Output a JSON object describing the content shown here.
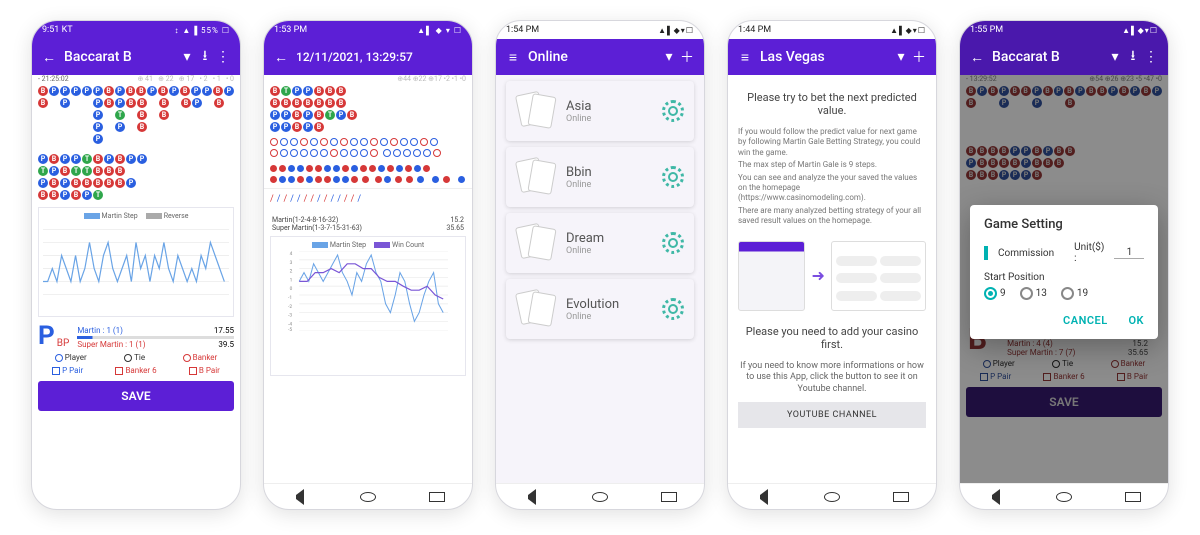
{
  "s1": {
    "status_time": "9:51 KT",
    "status_right": "↕ ▲ ▌55% ☐",
    "title": "Baccarat B",
    "sub": "- 21:25:02",
    "legend1": "Martin Step",
    "legend2": "Reverse",
    "bigP": "P",
    "bp": "BP",
    "martin": "Martin : 1 (1)",
    "super": "Super Martin : 1 (1)",
    "v1": "17.55",
    "v2": "39.5",
    "opt_player": "Player",
    "opt_tie": "Tie",
    "opt_banker": "Banker",
    "opt_ppair": "P Pair",
    "opt_banker6": "Banker 6",
    "opt_bpair": "B Pair",
    "save": "SAVE"
  },
  "s2": {
    "status_time": "1:53 PM",
    "status_right": "▲▌ ◆ ▾ ☐",
    "title": "12/11/2021, 13:29:57",
    "martin_row": "Martin(1-2-4-8-16-32)",
    "martin_val": "15.2",
    "super_row": "Super Martin(1-3-7-15-31-63)",
    "super_val": "35.65",
    "legend1": "Martin Step",
    "legend2": "Win Count"
  },
  "s3": {
    "status_time": "1:54 PM",
    "title": "Online",
    "items": [
      {
        "name": "Asia",
        "sub": "Online"
      },
      {
        "name": "Bbin",
        "sub": "Online"
      },
      {
        "name": "Dream",
        "sub": "Online"
      },
      {
        "name": "Evolution",
        "sub": "Online"
      }
    ]
  },
  "s4": {
    "status_time": "1:44 PM",
    "title": "Las Vegas",
    "headline": "Please try to bet the next predicted value.",
    "p1": "If you would follow the predict value for next game by following Martin Gale Betting Strategy, you could win the game.",
    "p2": "The max step of Martin Gale is 9 steps.",
    "p3": "You can see and analyze the your saved the values on the homepage (https://www.casinomodeling.com).",
    "p4": "There are many analyzed betting strategy of your all saved result values on the homepage.",
    "bottom1": "Please you need to add your casino first.",
    "bottom2": "If you need to know more informations or how to use this App, click the button to see it on Youtube channel.",
    "ytbtn": "YOUTUBE CHANNEL"
  },
  "s5": {
    "status_time": "1:55 PM",
    "title": "Baccarat B",
    "sub": "- 13:29:52",
    "dialog_title": "Game Setting",
    "commission": "Commission",
    "unit_label": "Unit($) :",
    "unit_val": "1",
    "start_pos": "Start Position",
    "r1": "9",
    "r2": "13",
    "r3": "19",
    "cancel": "CANCEL",
    "ok": "OK",
    "martin": "Martin : 4 (4)",
    "super": "Super Martin : 7 (7)",
    "v1": "15.2",
    "v2": "35.65",
    "save": "SAVE",
    "opt_player": "Player",
    "opt_tie": "Tie",
    "opt_banker": "Banker",
    "opt_ppair": "P Pair",
    "opt_banker6": "Banker 6",
    "opt_bpair": "B Pair"
  },
  "chart_data": [
    {
      "type": "line",
      "title": "Martin Step / Reverse",
      "screen": 1,
      "series": [
        {
          "name": "Martin Step",
          "values": [
            1,
            1,
            2,
            1,
            3,
            2,
            1,
            3,
            1,
            2,
            4,
            2,
            1,
            3,
            4,
            2,
            1,
            2,
            3,
            1,
            4,
            2,
            3,
            1,
            3,
            2,
            4,
            2,
            1,
            3,
            2,
            1,
            2,
            1,
            3,
            2,
            4,
            3,
            2,
            1,
            2,
            3,
            1,
            2
          ]
        },
        {
          "name": "Reverse",
          "values": [
            1,
            1,
            1,
            1,
            1,
            1,
            1,
            1,
            1,
            1,
            1,
            1,
            1,
            1,
            1,
            1,
            1,
            1,
            1,
            1,
            1,
            1,
            1,
            1,
            1,
            1,
            1,
            1,
            1,
            1,
            1,
            1,
            1,
            1,
            1,
            1,
            1,
            1,
            1,
            1,
            1,
            1,
            1,
            1
          ]
        }
      ],
      "ylim": [
        0,
        5
      ]
    },
    {
      "type": "line",
      "title": "Martin Step / Win Count",
      "screen": 2,
      "x": [
        1,
        2,
        3,
        4,
        5,
        6,
        7,
        8,
        9,
        10,
        11,
        12,
        13,
        14,
        15,
        16,
        17,
        18,
        19,
        20,
        21,
        22,
        23,
        24,
        25,
        26,
        27,
        28,
        29,
        30,
        31,
        32,
        33,
        34,
        35,
        36,
        37,
        38,
        39,
        40,
        41,
        42,
        43,
        44
      ],
      "series": [
        {
          "name": "Martin Step",
          "values": [
            1,
            2,
            1,
            3,
            2,
            1,
            2,
            3,
            4,
            2,
            1,
            -1,
            2,
            1,
            3,
            4,
            2,
            1,
            -2,
            -3,
            -1,
            2,
            1,
            -2,
            -4,
            -3,
            -1,
            1,
            2,
            -2,
            -3,
            -4,
            -2,
            -1,
            1,
            -3,
            -4,
            -2,
            -1,
            -3,
            -4,
            -5,
            -3,
            -2
          ]
        },
        {
          "name": "Win Count",
          "values": [
            1,
            1,
            2,
            2,
            3,
            3,
            3,
            2,
            2,
            3,
            4,
            4,
            3,
            3,
            2,
            2,
            3,
            3,
            2,
            1,
            1,
            2,
            2,
            1,
            0,
            0,
            1,
            1,
            2,
            1,
            0,
            -1,
            0,
            0,
            1,
            0,
            -1,
            -1,
            0,
            -1,
            -2,
            -3,
            -2,
            -1
          ]
        }
      ],
      "ylim": [
        -5,
        4
      ]
    }
  ]
}
